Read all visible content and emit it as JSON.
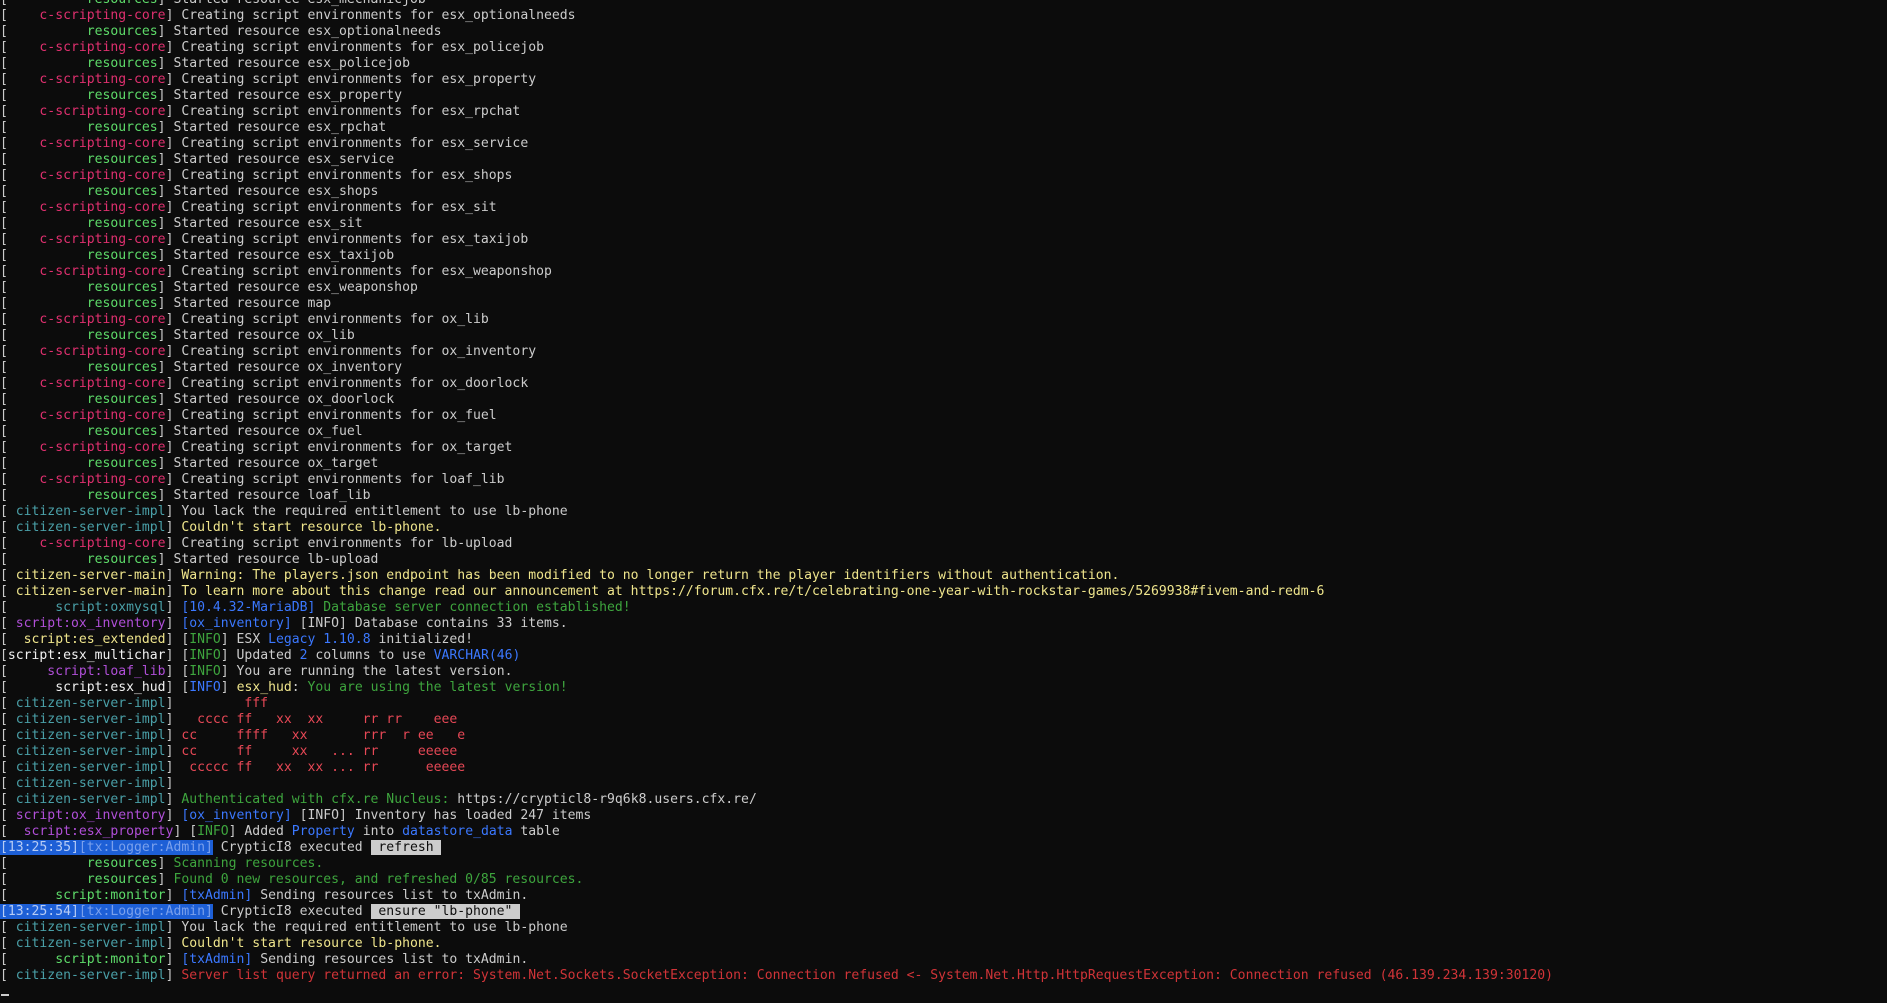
{
  "console": {
    "lines": [
      [
        [
          "[",
          "w"
        ],
        [
          "          resources",
          "gr"
        ],
        [
          "] ",
          "w"
        ],
        [
          "Started resource esx_mechanicjob",
          "w"
        ]
      ],
      [
        [
          "[",
          "w"
        ],
        [
          "    c-scripting-core",
          "pk"
        ],
        [
          "] ",
          "w"
        ],
        [
          "Creating script environments for esx_optionalneeds",
          "w"
        ]
      ],
      [
        [
          "[",
          "w"
        ],
        [
          "          resources",
          "gr"
        ],
        [
          "] ",
          "w"
        ],
        [
          "Started resource esx_optionalneeds",
          "w"
        ]
      ],
      [
        [
          "[",
          "w"
        ],
        [
          "    c-scripting-core",
          "pk"
        ],
        [
          "] ",
          "w"
        ],
        [
          "Creating script environments for esx_policejob",
          "w"
        ]
      ],
      [
        [
          "[",
          "w"
        ],
        [
          "          resources",
          "gr"
        ],
        [
          "] ",
          "w"
        ],
        [
          "Started resource esx_policejob",
          "w"
        ]
      ],
      [
        [
          "[",
          "w"
        ],
        [
          "    c-scripting-core",
          "pk"
        ],
        [
          "] ",
          "w"
        ],
        [
          "Creating script environments for esx_property",
          "w"
        ]
      ],
      [
        [
          "[",
          "w"
        ],
        [
          "          resources",
          "gr"
        ],
        [
          "] ",
          "w"
        ],
        [
          "Started resource esx_property",
          "w"
        ]
      ],
      [
        [
          "[",
          "w"
        ],
        [
          "    c-scripting-core",
          "pk"
        ],
        [
          "] ",
          "w"
        ],
        [
          "Creating script environments for esx_rpchat",
          "w"
        ]
      ],
      [
        [
          "[",
          "w"
        ],
        [
          "          resources",
          "gr"
        ],
        [
          "] ",
          "w"
        ],
        [
          "Started resource esx_rpchat",
          "w"
        ]
      ],
      [
        [
          "[",
          "w"
        ],
        [
          "    c-scripting-core",
          "pk"
        ],
        [
          "] ",
          "w"
        ],
        [
          "Creating script environments for esx_service",
          "w"
        ]
      ],
      [
        [
          "[",
          "w"
        ],
        [
          "          resources",
          "gr"
        ],
        [
          "] ",
          "w"
        ],
        [
          "Started resource esx_service",
          "w"
        ]
      ],
      [
        [
          "[",
          "w"
        ],
        [
          "    c-scripting-core",
          "pk"
        ],
        [
          "] ",
          "w"
        ],
        [
          "Creating script environments for esx_shops",
          "w"
        ]
      ],
      [
        [
          "[",
          "w"
        ],
        [
          "          resources",
          "gr"
        ],
        [
          "] ",
          "w"
        ],
        [
          "Started resource esx_shops",
          "w"
        ]
      ],
      [
        [
          "[",
          "w"
        ],
        [
          "    c-scripting-core",
          "pk"
        ],
        [
          "] ",
          "w"
        ],
        [
          "Creating script environments for esx_sit",
          "w"
        ]
      ],
      [
        [
          "[",
          "w"
        ],
        [
          "          resources",
          "gr"
        ],
        [
          "] ",
          "w"
        ],
        [
          "Started resource esx_sit",
          "w"
        ]
      ],
      [
        [
          "[",
          "w"
        ],
        [
          "    c-scripting-core",
          "pk"
        ],
        [
          "] ",
          "w"
        ],
        [
          "Creating script environments for esx_taxijob",
          "w"
        ]
      ],
      [
        [
          "[",
          "w"
        ],
        [
          "          resources",
          "gr"
        ],
        [
          "] ",
          "w"
        ],
        [
          "Started resource esx_taxijob",
          "w"
        ]
      ],
      [
        [
          "[",
          "w"
        ],
        [
          "    c-scripting-core",
          "pk"
        ],
        [
          "] ",
          "w"
        ],
        [
          "Creating script environments for esx_weaponshop",
          "w"
        ]
      ],
      [
        [
          "[",
          "w"
        ],
        [
          "          resources",
          "gr"
        ],
        [
          "] ",
          "w"
        ],
        [
          "Started resource esx_weaponshop",
          "w"
        ]
      ],
      [
        [
          "[",
          "w"
        ],
        [
          "          resources",
          "gr"
        ],
        [
          "] ",
          "w"
        ],
        [
          "Started resource map",
          "w"
        ]
      ],
      [
        [
          "[",
          "w"
        ],
        [
          "    c-scripting-core",
          "pk"
        ],
        [
          "] ",
          "w"
        ],
        [
          "Creating script environments for ox_lib",
          "w"
        ]
      ],
      [
        [
          "[",
          "w"
        ],
        [
          "          resources",
          "gr"
        ],
        [
          "] ",
          "w"
        ],
        [
          "Started resource ox_lib",
          "w"
        ]
      ],
      [
        [
          "[",
          "w"
        ],
        [
          "    c-scripting-core",
          "pk"
        ],
        [
          "] ",
          "w"
        ],
        [
          "Creating script environments for ox_inventory",
          "w"
        ]
      ],
      [
        [
          "[",
          "w"
        ],
        [
          "          resources",
          "gr"
        ],
        [
          "] ",
          "w"
        ],
        [
          "Started resource ox_inventory",
          "w"
        ]
      ],
      [
        [
          "[",
          "w"
        ],
        [
          "    c-scripting-core",
          "pk"
        ],
        [
          "] ",
          "w"
        ],
        [
          "Creating script environments for ox_doorlock",
          "w"
        ]
      ],
      [
        [
          "[",
          "w"
        ],
        [
          "          resources",
          "gr"
        ],
        [
          "] ",
          "w"
        ],
        [
          "Started resource ox_doorlock",
          "w"
        ]
      ],
      [
        [
          "[",
          "w"
        ],
        [
          "    c-scripting-core",
          "pk"
        ],
        [
          "] ",
          "w"
        ],
        [
          "Creating script environments for ox_fuel",
          "w"
        ]
      ],
      [
        [
          "[",
          "w"
        ],
        [
          "          resources",
          "gr"
        ],
        [
          "] ",
          "w"
        ],
        [
          "Started resource ox_fuel",
          "w"
        ]
      ],
      [
        [
          "[",
          "w"
        ],
        [
          "    c-scripting-core",
          "pk"
        ],
        [
          "] ",
          "w"
        ],
        [
          "Creating script environments for ox_target",
          "w"
        ]
      ],
      [
        [
          "[",
          "w"
        ],
        [
          "          resources",
          "gr"
        ],
        [
          "] ",
          "w"
        ],
        [
          "Started resource ox_target",
          "w"
        ]
      ],
      [
        [
          "[",
          "w"
        ],
        [
          "    c-scripting-core",
          "pk"
        ],
        [
          "] ",
          "w"
        ],
        [
          "Creating script environments for loaf_lib",
          "w"
        ]
      ],
      [
        [
          "[",
          "w"
        ],
        [
          "          resources",
          "gr"
        ],
        [
          "] ",
          "w"
        ],
        [
          "Started resource loaf_lib",
          "w"
        ]
      ],
      [
        [
          "[",
          "w"
        ],
        [
          " citizen-server-impl",
          "cy"
        ],
        [
          "] ",
          "w"
        ],
        [
          "You lack the required entitlement to use lb-phone",
          "w"
        ]
      ],
      [
        [
          "[",
          "w"
        ],
        [
          " citizen-server-impl",
          "cy"
        ],
        [
          "] ",
          "w"
        ],
        [
          "Couldn't start resource lb-phone.",
          "ye"
        ]
      ],
      [
        [
          "[",
          "w"
        ],
        [
          "    c-scripting-core",
          "pk"
        ],
        [
          "] ",
          "w"
        ],
        [
          "Creating script environments for lb-upload",
          "w"
        ]
      ],
      [
        [
          "[",
          "w"
        ],
        [
          "          resources",
          "gr"
        ],
        [
          "] ",
          "w"
        ],
        [
          "Started resource lb-upload",
          "w"
        ]
      ],
      [
        [
          "[",
          "w"
        ],
        [
          " citizen-server-main",
          "ye"
        ],
        [
          "] ",
          "w"
        ],
        [
          "Warning: The players.json endpoint has been modified to no longer return the player identifiers without authentication.",
          "ye"
        ]
      ],
      [
        [
          "[",
          "w"
        ],
        [
          " citizen-server-main",
          "ye"
        ],
        [
          "] ",
          "w"
        ],
        [
          "To learn more about this change read our announcement at https://forum.cfx.re/t/celebrating-one-year-with-rockstar-games/5269938#fivem-and-redm-6",
          "ye"
        ]
      ],
      [
        [
          "[",
          "w"
        ],
        [
          "      script:oxmysql",
          "cy"
        ],
        [
          "] ",
          "w"
        ],
        [
          "[10.4.32-MariaDB] ",
          "bl"
        ],
        [
          "Database server connection established!",
          "dg"
        ]
      ],
      [
        [
          "[",
          "w"
        ],
        [
          " script:ox_inventory",
          "mg"
        ],
        [
          "] ",
          "w"
        ],
        [
          "[ox_inventory] ",
          "bl"
        ],
        [
          "[INFO] Database contains 33 items.",
          "w"
        ]
      ],
      [
        [
          "[",
          "w"
        ],
        [
          "  script:es_extended",
          "ye"
        ],
        [
          "] ",
          "w"
        ],
        [
          "[",
          "w"
        ],
        [
          "INFO",
          "dg"
        ],
        [
          "] ESX ",
          "w"
        ],
        [
          "Legacy 1.10.8",
          "bl"
        ],
        [
          " initialized!",
          "w"
        ]
      ],
      [
        [
          "[",
          "w"
        ],
        [
          "script:esx_multichar",
          "br"
        ],
        [
          "] ",
          "w"
        ],
        [
          "[",
          "w"
        ],
        [
          "INFO",
          "dg"
        ],
        [
          "] Updated ",
          "w"
        ],
        [
          "2",
          "bl"
        ],
        [
          " columns to use ",
          "w"
        ],
        [
          "VARCHAR(46)",
          "bl"
        ]
      ],
      [
        [
          "[",
          "w"
        ],
        [
          "     script:loaf_lib",
          "mg"
        ],
        [
          "] ",
          "w"
        ],
        [
          "[",
          "w"
        ],
        [
          "INFO",
          "dg"
        ],
        [
          "] You are running the latest version.",
          "w"
        ]
      ],
      [
        [
          "[",
          "w"
        ],
        [
          "      script:esx_hud",
          "br"
        ],
        [
          "] ",
          "w"
        ],
        [
          "[",
          "w"
        ],
        [
          "INFO",
          "bl"
        ],
        [
          "] ",
          "w"
        ],
        [
          "esx_hud",
          "ye"
        ],
        [
          ": ",
          "w"
        ],
        [
          "You are using the latest version!",
          "dg"
        ]
      ],
      [
        [
          "[",
          "w"
        ],
        [
          " citizen-server-impl",
          "cy"
        ],
        [
          "] ",
          "w"
        ],
        [
          "        fff",
          "rd"
        ]
      ],
      [
        [
          "[",
          "w"
        ],
        [
          " citizen-server-impl",
          "cy"
        ],
        [
          "] ",
          "w"
        ],
        [
          "  cccc ff   xx  xx     rr rr    eee",
          "rd"
        ]
      ],
      [
        [
          "[",
          "w"
        ],
        [
          " citizen-server-impl",
          "cy"
        ],
        [
          "] ",
          "w"
        ],
        [
          "cc     ffff   xx       rrr  r ee   e",
          "rd"
        ]
      ],
      [
        [
          "[",
          "w"
        ],
        [
          " citizen-server-impl",
          "cy"
        ],
        [
          "] ",
          "w"
        ],
        [
          "cc     ff     xx   ... rr     eeeee",
          "rd"
        ]
      ],
      [
        [
          "[",
          "w"
        ],
        [
          " citizen-server-impl",
          "cy"
        ],
        [
          "] ",
          "w"
        ],
        [
          " ccccc ff   xx  xx ... rr      eeeee",
          "rd"
        ]
      ],
      [
        [
          "[",
          "w"
        ],
        [
          " citizen-server-impl",
          "cy"
        ],
        [
          "] ",
          "w"
        ]
      ],
      [
        [
          "[",
          "w"
        ],
        [
          " citizen-server-impl",
          "cy"
        ],
        [
          "] ",
          "w"
        ],
        [
          "Authenticated with cfx.re Nucleus: ",
          "dg"
        ],
        [
          "https://crypticl8-r9q6k8.users.cfx.re/",
          "w"
        ]
      ],
      [
        [
          "[",
          "w"
        ],
        [
          " script:ox_inventory",
          "mg"
        ],
        [
          "] ",
          "w"
        ],
        [
          "[ox_inventory] ",
          "bl"
        ],
        [
          "[INFO] Inventory has loaded 247 items",
          "w"
        ]
      ],
      [
        [
          "[",
          "w"
        ],
        [
          "  script:esx_property",
          "mg"
        ],
        [
          "] ",
          "w"
        ],
        [
          "[",
          "w"
        ],
        [
          "INFO",
          "dg"
        ],
        [
          "] Added ",
          "w"
        ],
        [
          "Property",
          "bl"
        ],
        [
          " into ",
          "w"
        ],
        [
          "datastore_data",
          "bl"
        ],
        [
          " table",
          "w"
        ]
      ],
      [
        [
          "[13:25:35]",
          "ts"
        ],
        [
          "[tx:Logger:Admin]",
          "tag"
        ],
        [
          " CrypticI8 executed ",
          "w"
        ],
        [
          " refresh ",
          "cmd"
        ]
      ],
      [
        [
          "[",
          "w"
        ],
        [
          "          resources",
          "gr"
        ],
        [
          "] ",
          "w"
        ],
        [
          "Scanning resources.",
          "dg"
        ]
      ],
      [
        [
          "[",
          "w"
        ],
        [
          "          resources",
          "gr"
        ],
        [
          "] ",
          "w"
        ],
        [
          "Found 0 new resources, and refreshed 0/85 resources.",
          "dg"
        ]
      ],
      [
        [
          "[",
          "w"
        ],
        [
          "      script:monitor",
          "gr"
        ],
        [
          "] ",
          "w"
        ],
        [
          "[txAdmin] ",
          "bl"
        ],
        [
          "Sending resources list to txAdmin.",
          "w"
        ]
      ],
      [
        [
          "[13:25:54]",
          "ts"
        ],
        [
          "[tx:Logger:Admin]",
          "tag"
        ],
        [
          " CrypticI8 executed ",
          "w"
        ],
        [
          " ensure \"lb-phone\" ",
          "cmd"
        ]
      ],
      [
        [
          "[",
          "w"
        ],
        [
          " citizen-server-impl",
          "cy"
        ],
        [
          "] ",
          "w"
        ],
        [
          "You lack the required entitlement to use lb-phone",
          "w"
        ]
      ],
      [
        [
          "[",
          "w"
        ],
        [
          " citizen-server-impl",
          "cy"
        ],
        [
          "] ",
          "w"
        ],
        [
          "Couldn't start resource lb-phone.",
          "ye"
        ]
      ],
      [
        [
          "[",
          "w"
        ],
        [
          "      script:monitor",
          "gr"
        ],
        [
          "] ",
          "w"
        ],
        [
          "[txAdmin] ",
          "bl"
        ],
        [
          "Sending resources list to txAdmin.",
          "w"
        ]
      ],
      [
        [
          "[",
          "w"
        ],
        [
          " citizen-server-impl",
          "cy"
        ],
        [
          "] ",
          "w"
        ],
        [
          "Server list query returned an error: System.Net.Sockets.SocketException: Connection refused <- System.Net.Http.HttpRequestException: Connection refused (46.139.234.139:30120)",
          "bdr"
        ]
      ]
    ]
  }
}
